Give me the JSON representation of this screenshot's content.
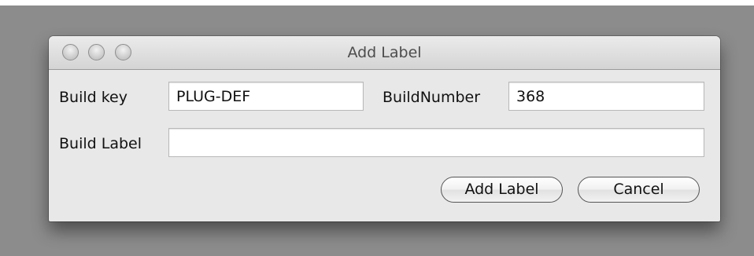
{
  "window": {
    "title": "Add Label"
  },
  "form": {
    "build_key_label": "Build key",
    "build_key_value": "PLUG-DEF",
    "build_number_label": "BuildNumber",
    "build_number_value": "368",
    "build_label_label": "Build Label",
    "build_label_value": ""
  },
  "buttons": {
    "add_label": "Add Label",
    "cancel": "Cancel"
  },
  "colors": {
    "backdrop": "#8c8c8c",
    "window_bg": "#e8e8e8"
  }
}
